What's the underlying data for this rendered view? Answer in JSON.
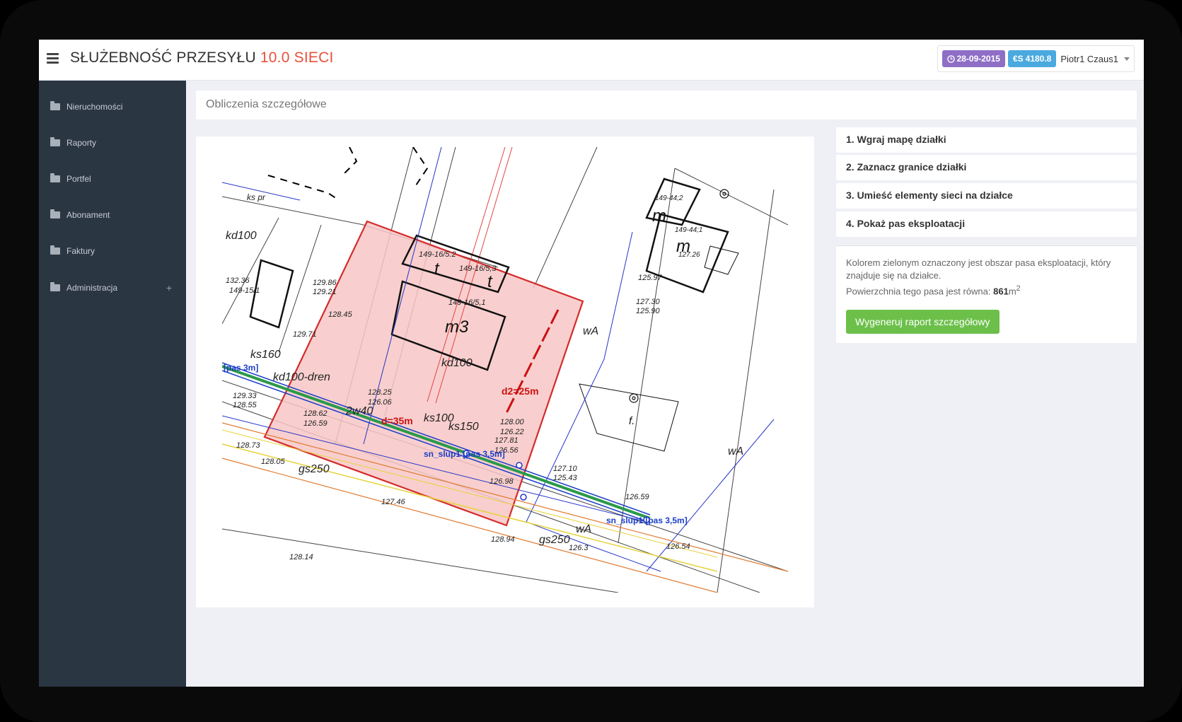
{
  "header": {
    "title": "SŁUŻEBNOŚĆ PRZESYŁU",
    "title_accent": "10.0 SIECI",
    "date_badge": "28-09-2015",
    "credit_badge": "4180.8",
    "user": "Piotr1 Czaus1"
  },
  "sidebar": {
    "items": [
      {
        "label": "Nieruchomości"
      },
      {
        "label": "Raporty"
      },
      {
        "label": "Portfel"
      },
      {
        "label": "Abonament"
      },
      {
        "label": "Faktury"
      },
      {
        "label": "Administracja",
        "expand": "+"
      }
    ]
  },
  "page": {
    "section_title": "Obliczenia szczegółowe"
  },
  "steps": [
    {
      "label": "1. Wgraj mapę działki"
    },
    {
      "label": "2. Zaznacz granice działki"
    },
    {
      "label": "3. Umieść elementy sieci na działce"
    },
    {
      "label": "4. Pokaż pas eksploatacji"
    }
  ],
  "info": {
    "text_line1": "Kolorem zielonym oznaczony jest obszar pasa eksploatacji, który znajduje się na działce.",
    "text_line2_prefix": "Powierzchnia tego pasa jest równa: ",
    "area_value": "861",
    "area_unit": "m",
    "area_sup": "2",
    "button": "Wygeneruj raport szczegółowy"
  },
  "map": {
    "labels": {
      "pas_left": "[pas 3m]",
      "slup1": "sn_slup1 [pas 3,5m]",
      "slup2": "sn_slup1 [pas 3,5m]",
      "d2": "d2=25m",
      "d": "d=35m",
      "m3": "m3",
      "t1": "t",
      "t2": "t",
      "m_right": "m",
      "m_small": "m",
      "f": "f.",
      "p1": "149-16/5.2",
      "p2": "149-16/5,3",
      "p3": "149-16/5,1",
      "p4": "149-44;2",
      "p5": "149-44;1",
      "p6": "127.26",
      "v1": "128.25",
      "v2": "126.06",
      "v3": "128.62",
      "v4": "126.59",
      "v5": "128.00",
      "v6": "126.22",
      "v7": "127.81",
      "v8": "126.56",
      "v9": "127.10",
      "v10": "125.43",
      "v11": "126.98",
      "v12": "126.59",
      "v13": "126.54",
      "v14": "125.97",
      "v15": "127.30",
      "v16": "125.90",
      "v17": "129.71",
      "v18": "129.86",
      "v19": "129.21",
      "v20": "129.33",
      "v21": "128.55",
      "v22": "132.36",
      "v23": "149-15/1",
      "v24": "128.94",
      "v25": "127.46",
      "v26": "128.14",
      "v27": "126.3",
      "v28": "128.45",
      "v29": "128.73",
      "v30": "128.05",
      "gs1": "gs250",
      "gs2": "gs250",
      "ks1": "ks100",
      "ks2": "ks150",
      "ks3": "ks160",
      "ks4": "kd100-dren",
      "ks5": "2w40",
      "ks6": "kd100",
      "ks7": "kd100",
      "ks8": "ks pr",
      "wA1": "wA",
      "wA2": "wA",
      "wA3": "wA"
    }
  }
}
